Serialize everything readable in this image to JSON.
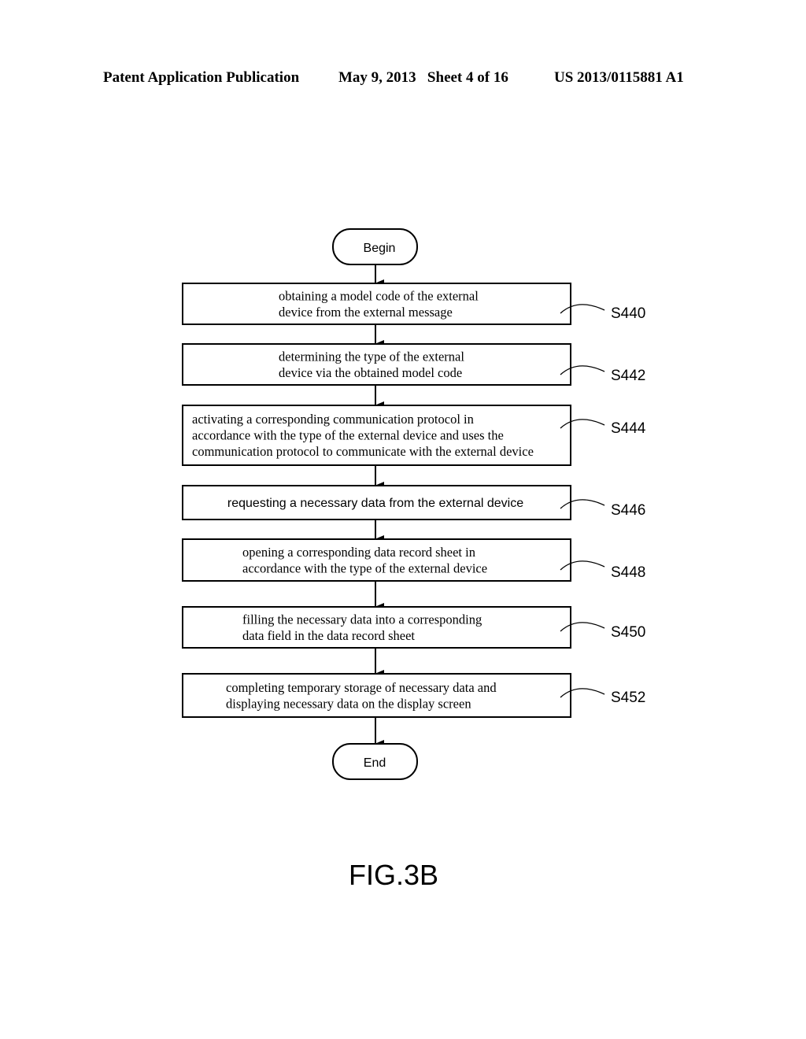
{
  "header": {
    "publication": "Patent Application Publication",
    "date_sheet": "May 9, 2013   Sheet 4 of 16",
    "number": "US 2013/0115881 A1"
  },
  "flowchart": {
    "begin": "Begin",
    "end": "End",
    "steps": [
      {
        "id": "S440",
        "lines": [
          "obtaining a model code of the external",
          "device from the external message"
        ]
      },
      {
        "id": "S442",
        "lines": [
          "determining the type of the external",
          "device via the obtained model code"
        ]
      },
      {
        "id": "S444",
        "lines": [
          "activating a corresponding communication protocol in",
          "accordance with the type of the external device and uses the",
          "communication protocol to communicate with the external device"
        ]
      },
      {
        "id": "S446",
        "lines": [
          "requesting a necessary data from the external device"
        ]
      },
      {
        "id": "S448",
        "lines": [
          "opening a corresponding data record sheet in",
          "accordance with the type of the external device"
        ]
      },
      {
        "id": "S450",
        "lines": [
          "filling the necessary data into a corresponding",
          "data field in the data record sheet"
        ]
      },
      {
        "id": "S452",
        "lines": [
          "completing temporary storage of necessary data and",
          "displaying necessary data on the display screen"
        ]
      }
    ]
  },
  "figure_label": "FIG.3B"
}
